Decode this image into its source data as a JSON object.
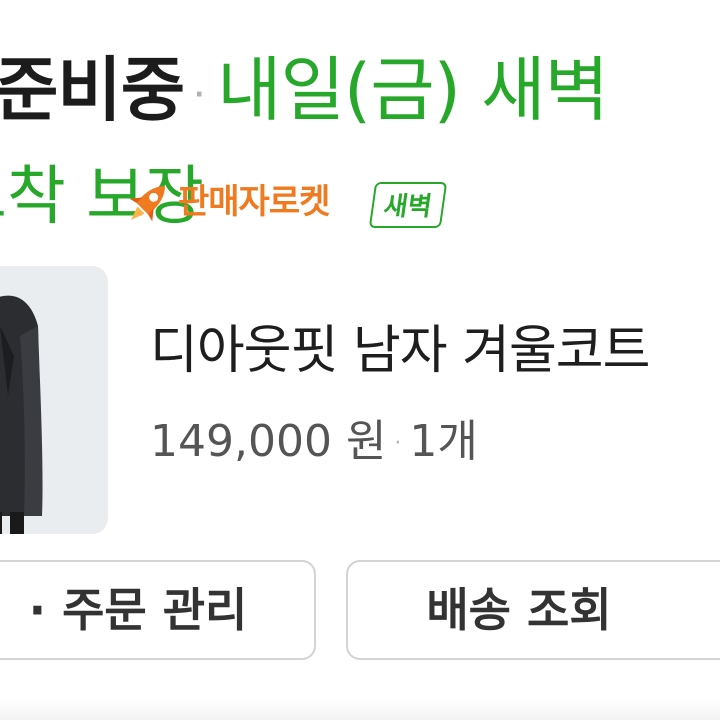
{
  "delivery": {
    "status": "준비중",
    "separator": "·",
    "eta": "내일(금) 새벽",
    "eta_line2": "도착 보장"
  },
  "seller_rocket": {
    "label": "판매자로켓",
    "badge": "새벽",
    "icon": "rocket-icon"
  },
  "product": {
    "name": "디아웃핏 남자 겨울코트",
    "price": "149,000 원",
    "separator": "·",
    "quantity": "1개",
    "thumbnail_icon": "coat-photo"
  },
  "actions": {
    "order_manage": "· 주문 관리",
    "track_delivery": "배송 조회"
  },
  "colors": {
    "green": "#27a82b",
    "orange": "#f07a1f",
    "text": "#1c1c1c",
    "muted": "#555555"
  }
}
